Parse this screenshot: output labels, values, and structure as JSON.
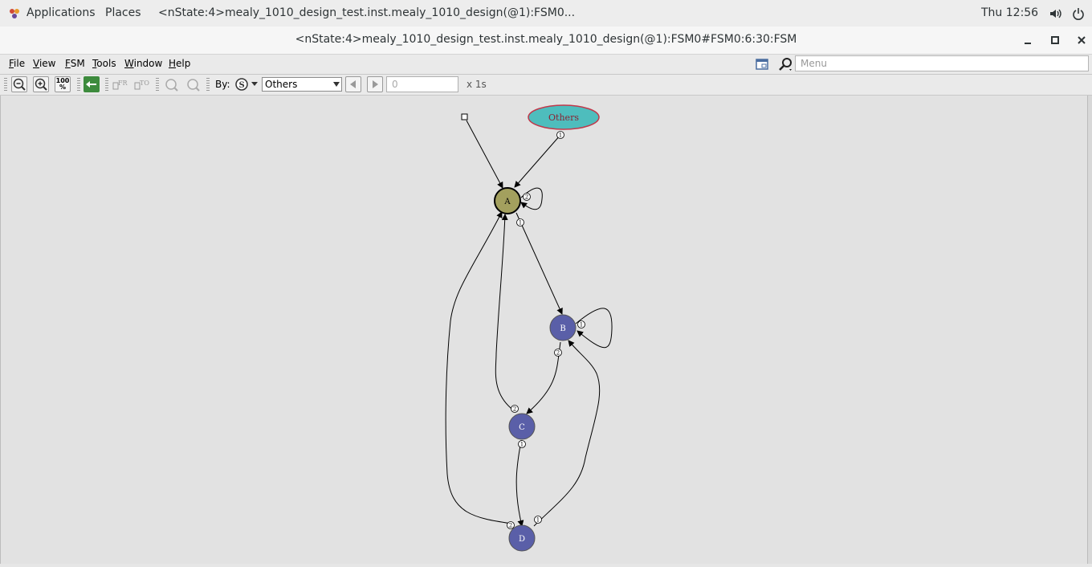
{
  "topbar": {
    "applications": "Applications",
    "places": "Places",
    "window_title": "<nState:4>mealy_1010_design_test.inst.mealy_1010_design(@1):FSM0...",
    "clock": "Thu 12:56"
  },
  "window": {
    "title": "<nState:4>mealy_1010_design_test.inst.mealy_1010_design(@1):FSM0#FSM0:6:30:FSM"
  },
  "menubar": {
    "items": [
      {
        "accel": "F",
        "rest": "ile"
      },
      {
        "accel": "V",
        "rest": "iew"
      },
      {
        "accel": "F",
        "rest": "SM"
      },
      {
        "accel": "T",
        "rest": "ools"
      },
      {
        "accel": "W",
        "rest": "indow"
      },
      {
        "accel": "H",
        "rest": "elp"
      }
    ],
    "search_placeholder": "Menu"
  },
  "toolbar": {
    "zoom_100_label": "100\n%",
    "by_label": "By:",
    "by_select": "Others",
    "step_value": "0",
    "step_unit": "x 1s"
  },
  "fsm": {
    "init_node_label": "Others",
    "states": [
      {
        "name": "A",
        "color": "#a3a05e"
      },
      {
        "name": "B",
        "color": "#5a5fa8"
      },
      {
        "name": "C",
        "color": "#5a5fa8"
      },
      {
        "name": "D",
        "color": "#5a5fa8"
      }
    ],
    "others_fill": "#4ebdbd",
    "others_stroke": "#c0394b",
    "edge_labels": {
      "others_to_a": "1",
      "a_self": "2",
      "a_to_b": "1",
      "b_self": "1",
      "b_to_c": "2",
      "c_to_a": "2",
      "c_to_d": "1",
      "d_to_b": "1",
      "d_to_a": "2"
    }
  }
}
